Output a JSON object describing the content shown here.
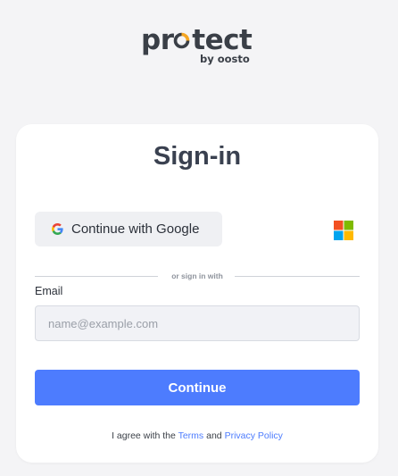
{
  "brand": {
    "name_prefix": "pr",
    "name_o": "o",
    "name_suffix": "tect",
    "tagline": "by oosto",
    "accent_color": "#f5a623",
    "text_color": "#3a3f47"
  },
  "signin": {
    "title": "Sign-in",
    "google_button_label": "Continue with Google",
    "google_icon": "google-icon",
    "microsoft_icon": "microsoft-icon",
    "divider_text": "or sign in with",
    "email_label": "Email",
    "email_placeholder": "name@example.com",
    "email_value": "",
    "continue_label": "Continue",
    "terms_prefix": "I agree with the",
    "terms_link": "Terms",
    "terms_and": "and",
    "privacy_link": "Privacy Policy"
  },
  "colors": {
    "background": "#f4f4f6",
    "card": "#ffffff",
    "primary": "#4d7cfe",
    "link": "#4d7cfe"
  }
}
